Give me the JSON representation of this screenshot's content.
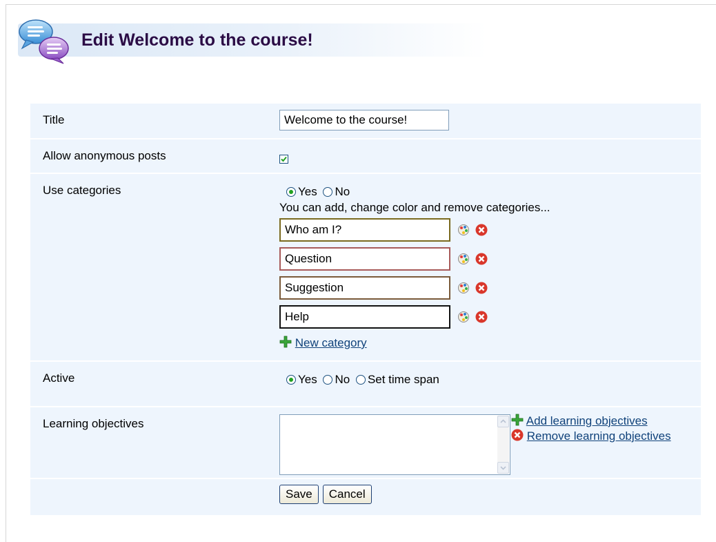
{
  "page": {
    "title": "Edit Welcome to the course!"
  },
  "form": {
    "title": {
      "label": "Title",
      "value": "Welcome to the course!"
    },
    "anonymous": {
      "label": "Allow anonymous posts",
      "checked": true
    },
    "categories": {
      "label": "Use categories",
      "yes_label": "Yes",
      "no_label": "No",
      "selected": "Yes",
      "hint": "You can add, change color and remove categories...",
      "items": [
        {
          "name": "Who am I?",
          "color": "#7a6a1f"
        },
        {
          "name": "Question",
          "color": "#a85a5a"
        },
        {
          "name": "Suggestion",
          "color": "#7a5a3a"
        },
        {
          "name": "Help",
          "color": "#111111"
        }
      ],
      "new_label": "New category"
    },
    "active": {
      "label": "Active",
      "yes_label": "Yes",
      "no_label": "No",
      "timespan_label": "Set time span",
      "selected": "Yes"
    },
    "objectives": {
      "label": "Learning objectives",
      "value": "",
      "add_label": "Add learning objectives",
      "remove_label": "Remove learning objectives"
    },
    "buttons": {
      "save": "Save",
      "cancel": "Cancel"
    }
  }
}
